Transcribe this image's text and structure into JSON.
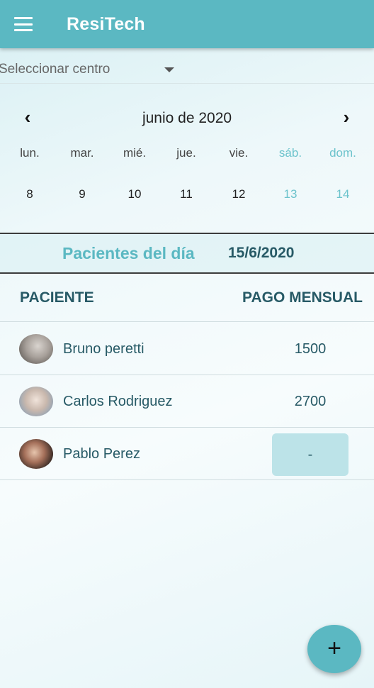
{
  "appbar": {
    "title": "ResiTech",
    "menu_icon": "hamburger-menu-icon"
  },
  "center_select": {
    "placeholder": "Seleccionar centro",
    "caret_icon": "caret-down-icon"
  },
  "calendar": {
    "month_title": "junio de 2020",
    "prev_icon": "chevron-left-icon",
    "next_icon": "chevron-right-icon",
    "prev_glyph": "‹",
    "next_glyph": "›",
    "weekdays": [
      "lun.",
      "mar.",
      "mié.",
      "jue.",
      "vie.",
      "sáb.",
      "dom."
    ],
    "days": [
      "8",
      "9",
      "10",
      "11",
      "12",
      "13",
      "14"
    ]
  },
  "day_header": {
    "label": "Pacientes del día",
    "date": "15/6/2020"
  },
  "table": {
    "col_patient": "PACIENTE",
    "col_payment": "PAGO MENSUAL",
    "rows": [
      {
        "name": "Bruno peretti",
        "amount": "1500"
      },
      {
        "name": "Carlos Rodriguez",
        "amount": "2700"
      },
      {
        "name": "Pablo Perez",
        "amount": "-"
      }
    ]
  },
  "fab": {
    "label": "+",
    "icon": "plus-icon"
  },
  "colors": {
    "primary": "#5bb8c2",
    "dark_text": "#275a66",
    "weekend": "#6cc3cc",
    "pending_button": "#bce3e8"
  }
}
